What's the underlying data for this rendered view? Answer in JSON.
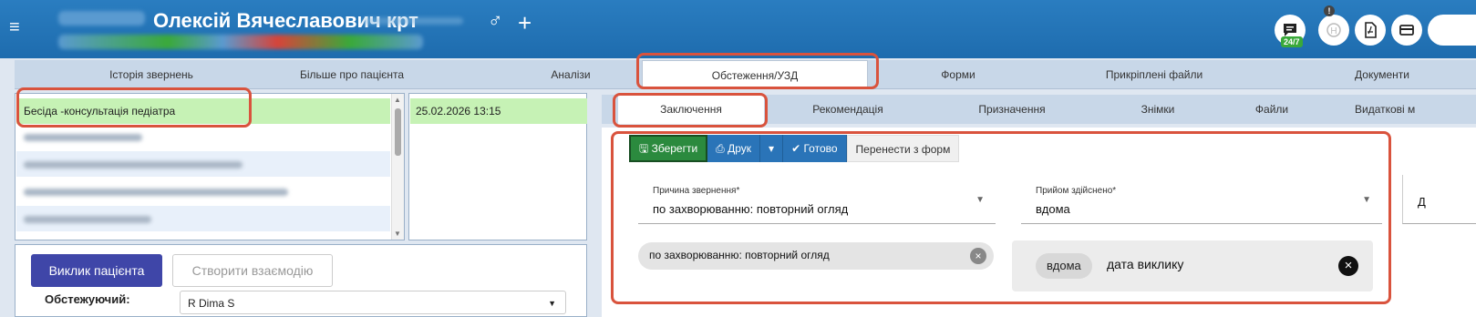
{
  "header": {
    "menu_icon": "hamburger-icon",
    "patient_name": "Олексій Вячеславович крт",
    "gender_symbol": "♂",
    "add_symbol": "+",
    "badge_247": "24/7",
    "badge_alert": "!",
    "icons": [
      "chat-icon",
      "signature-icon",
      "pdf-icon",
      "card-icon"
    ]
  },
  "main_tabs": [
    "Історія звернень",
    "Більше про пацієнта",
    "Аналізи",
    "Обстеження/УЗД",
    "Форми",
    "Прикріплені файли",
    "Документи"
  ],
  "visit_list": {
    "selected": "Бесіда -консультація  педіатра",
    "date": "25.02.2026 13:15"
  },
  "lower_left": {
    "call_button": "Виклик пацієнта",
    "create_button": "Створити взаємодію",
    "examiner_label": "Обстежуючий:",
    "examiner_value": "R Dima S"
  },
  "sub_tabs": [
    "Заключення",
    "Рекомендація",
    "Призначення",
    "Знімки",
    "Файли",
    "Видаткові м"
  ],
  "toolbar": {
    "save": "Зберегти",
    "print": "Друк",
    "ready": "Готово",
    "move": "Перенести з форм"
  },
  "form": {
    "reason_label": "Причина звернення*",
    "reason_value": "по захворюванню: повторний огляд",
    "place_label": "Прийом здійснено*",
    "place_value": "вдома",
    "third_label_cut": "Д",
    "reason_chip": "по захворюванню: повторний огляд",
    "place_chip": "вдома",
    "place_extra": "дата виклику"
  },
  "colors": {
    "accent_blue": "#1e6cae",
    "selected_green": "#c6f2b5",
    "highlight_red": "#d9533d",
    "button_primary": "#3f46a8"
  }
}
